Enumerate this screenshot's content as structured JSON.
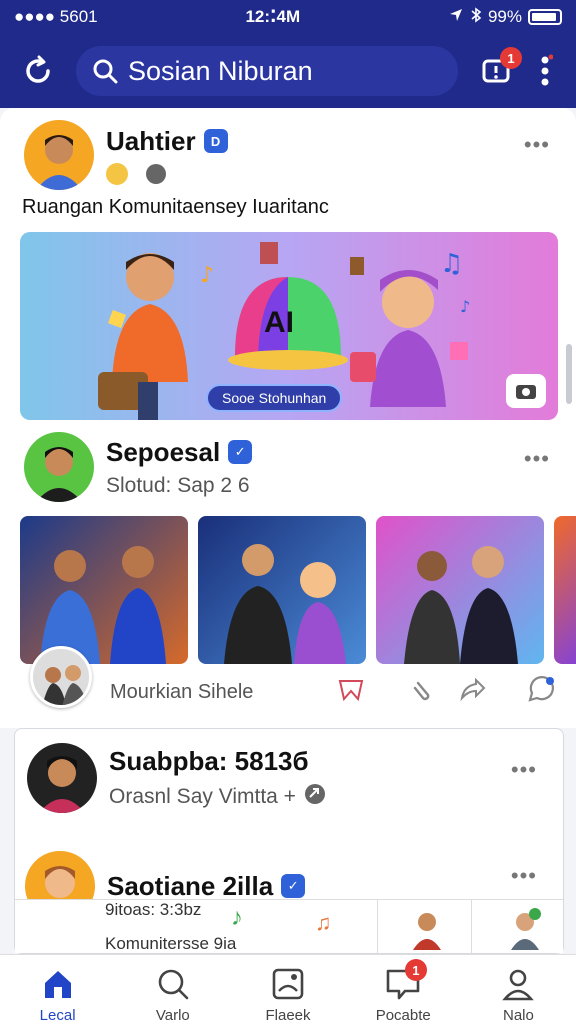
{
  "status": {
    "left": "●●●● 5601",
    "time": "12:⁚4M",
    "battery": "99%"
  },
  "topbar": {
    "search_text": "Sosian Niburan",
    "notif_count": "1"
  },
  "posts": [
    {
      "name": "Uahtier",
      "badge": "D",
      "caption": "Ruangan Komunitaensey Iuaritanc",
      "banner_label": "Sooe Stohunhan",
      "banner_title": "AI"
    },
    {
      "name": "Sepoesal",
      "sub": "Slotud: Sap 2 ⁠⁠6",
      "action_label": "Mourkian Sihele"
    },
    {
      "name": "Suabpba: 5813б",
      "sub": "Orasnl Say Vimtta +",
      "name2": "Saotiane 2illa",
      "strip1": "9itoas: 3:3bz",
      "strip2": "Komunitersse 9ia"
    }
  ],
  "nav": [
    {
      "label": "Lecal"
    },
    {
      "label": "Varlo"
    },
    {
      "label": "Flaeek"
    },
    {
      "label": "Pocabte",
      "badge": "1"
    },
    {
      "label": "Nalo"
    }
  ],
  "colors": {
    "brand": "#1f2a8a",
    "accent": "#2245c7",
    "alert": "#e53935"
  }
}
